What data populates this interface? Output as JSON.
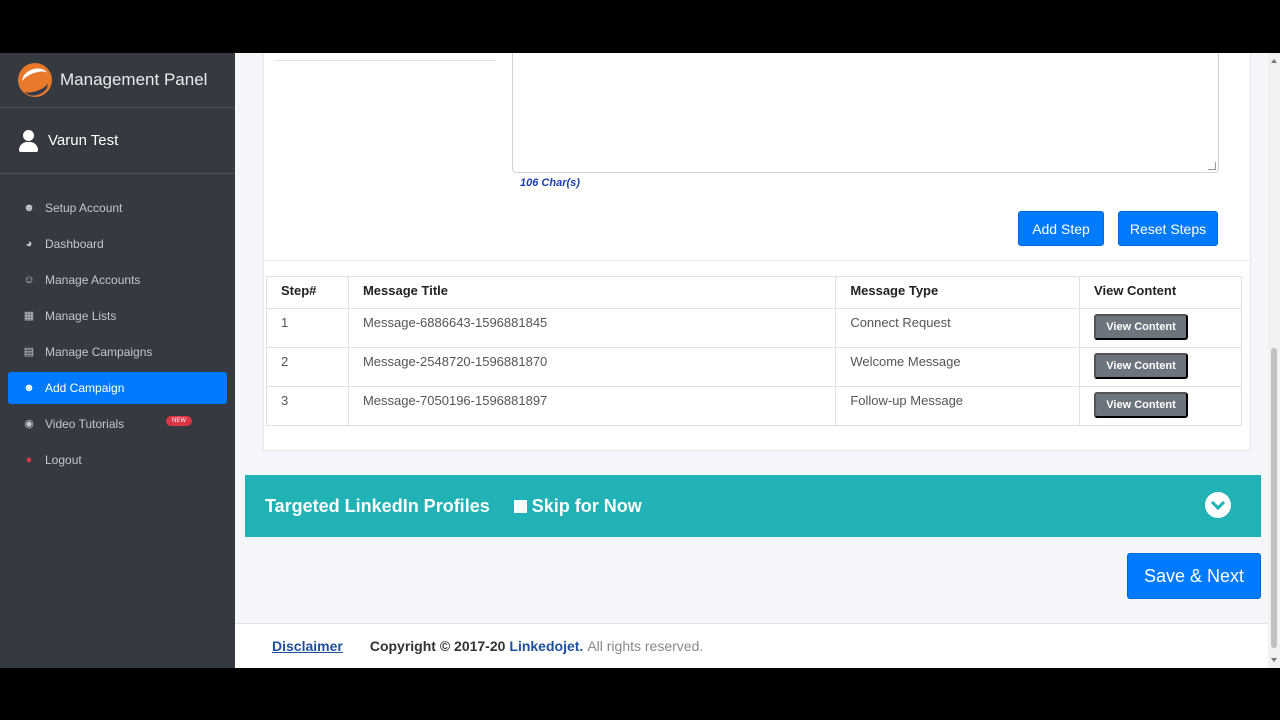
{
  "sidebar": {
    "brand": "Management Panel",
    "user": "Varun Test",
    "items": [
      {
        "label": "Setup Account",
        "icon": "user-plus-icon"
      },
      {
        "label": "Dashboard",
        "icon": "dashboard-gauge-icon"
      },
      {
        "label": "Manage Accounts",
        "icon": "users-icon"
      },
      {
        "label": "Manage Lists",
        "icon": "list-icon"
      },
      {
        "label": "Manage Campaigns",
        "icon": "campaign-icon"
      },
      {
        "label": "Add Campaign",
        "icon": "users-group-icon",
        "active": true
      },
      {
        "label": "Video Tutorials",
        "icon": "play-circle-icon",
        "badge": "NEW"
      },
      {
        "label": "Logout",
        "icon": "power-icon"
      }
    ]
  },
  "editor": {
    "char_count": "106 Char(s)",
    "add_step_label": "Add Step",
    "reset_steps_label": "Reset Steps"
  },
  "steps_table": {
    "headers": [
      "Step#",
      "Message Title",
      "Message Type",
      "View Content"
    ],
    "rows": [
      {
        "step": "1",
        "title": "Message-6886643-1596881845",
        "type": "Connect Request",
        "action": "View Content"
      },
      {
        "step": "2",
        "title": "Message-2548720-1596881870",
        "type": "Welcome Message",
        "action": "View Content"
      },
      {
        "step": "3",
        "title": "Message-7050196-1596881897",
        "type": "Follow-up Message",
        "action": "View Content"
      }
    ]
  },
  "targeted": {
    "title": "Targeted LinkedIn Profiles",
    "skip_label": "Skip for Now"
  },
  "save_next_label": "Save & Next",
  "footer": {
    "disclaimer": "Disclaimer",
    "copyright": "Copyright © 2017-20",
    "brand": "Linkedojet.",
    "rights": "All rights reserved."
  },
  "colors": {
    "sidebar_bg": "#343a40",
    "primary": "#007bff",
    "teal": "#20b2b5",
    "secondary": "#6c757d",
    "badge": "#dc3545"
  }
}
